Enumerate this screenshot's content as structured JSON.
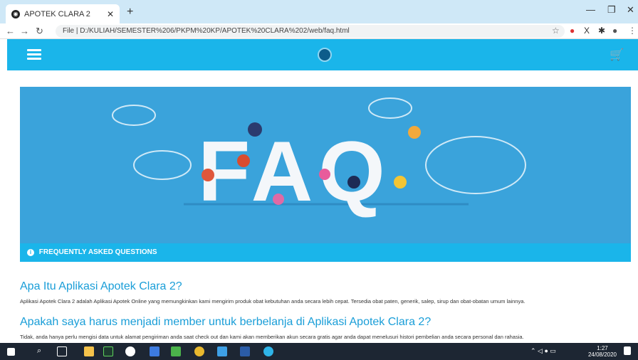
{
  "browser": {
    "tab_title": "APOTEK CLARA 2",
    "address": "File  |  D:/KULIAH/SEMESTER%206/PKPM%20KP/APOTEK%20CLARA%202/web/faq.html"
  },
  "site": {
    "hero_text": "FAQ",
    "banner_label": "FREQUENTLY ASKED QUESTIONS",
    "faqs": [
      {
        "question": "Apa Itu Aplikasi Apotek Clara 2?",
        "answer": "Aplikasi Apotek Clara 2 adalah Aplikasi Apotek Online yang memungkinkan kami mengirim produk obat kebutuhan anda secara lebih cepat. Tersedia obat paten, generik, salep, sirup dan obat-obatan umum lainnya."
      },
      {
        "question": "Apakah saya harus menjadi member untuk berbelanja di Aplikasi Apotek Clara 2?",
        "answer": "Tidak, anda hanya perlu mengisi data untuk alamat pengiriman anda saat check out dan kami akan memberikan akun secara gratis agar anda dapat menelusuri histori pembelian anda secara personal dan rahasia."
      }
    ]
  },
  "taskbar": {
    "time": "1:27",
    "date": "24/08/2020"
  },
  "colors": {
    "accent": "#1ab5ea",
    "hero_bg": "#3aa3db",
    "question": "#1a9ed8"
  }
}
